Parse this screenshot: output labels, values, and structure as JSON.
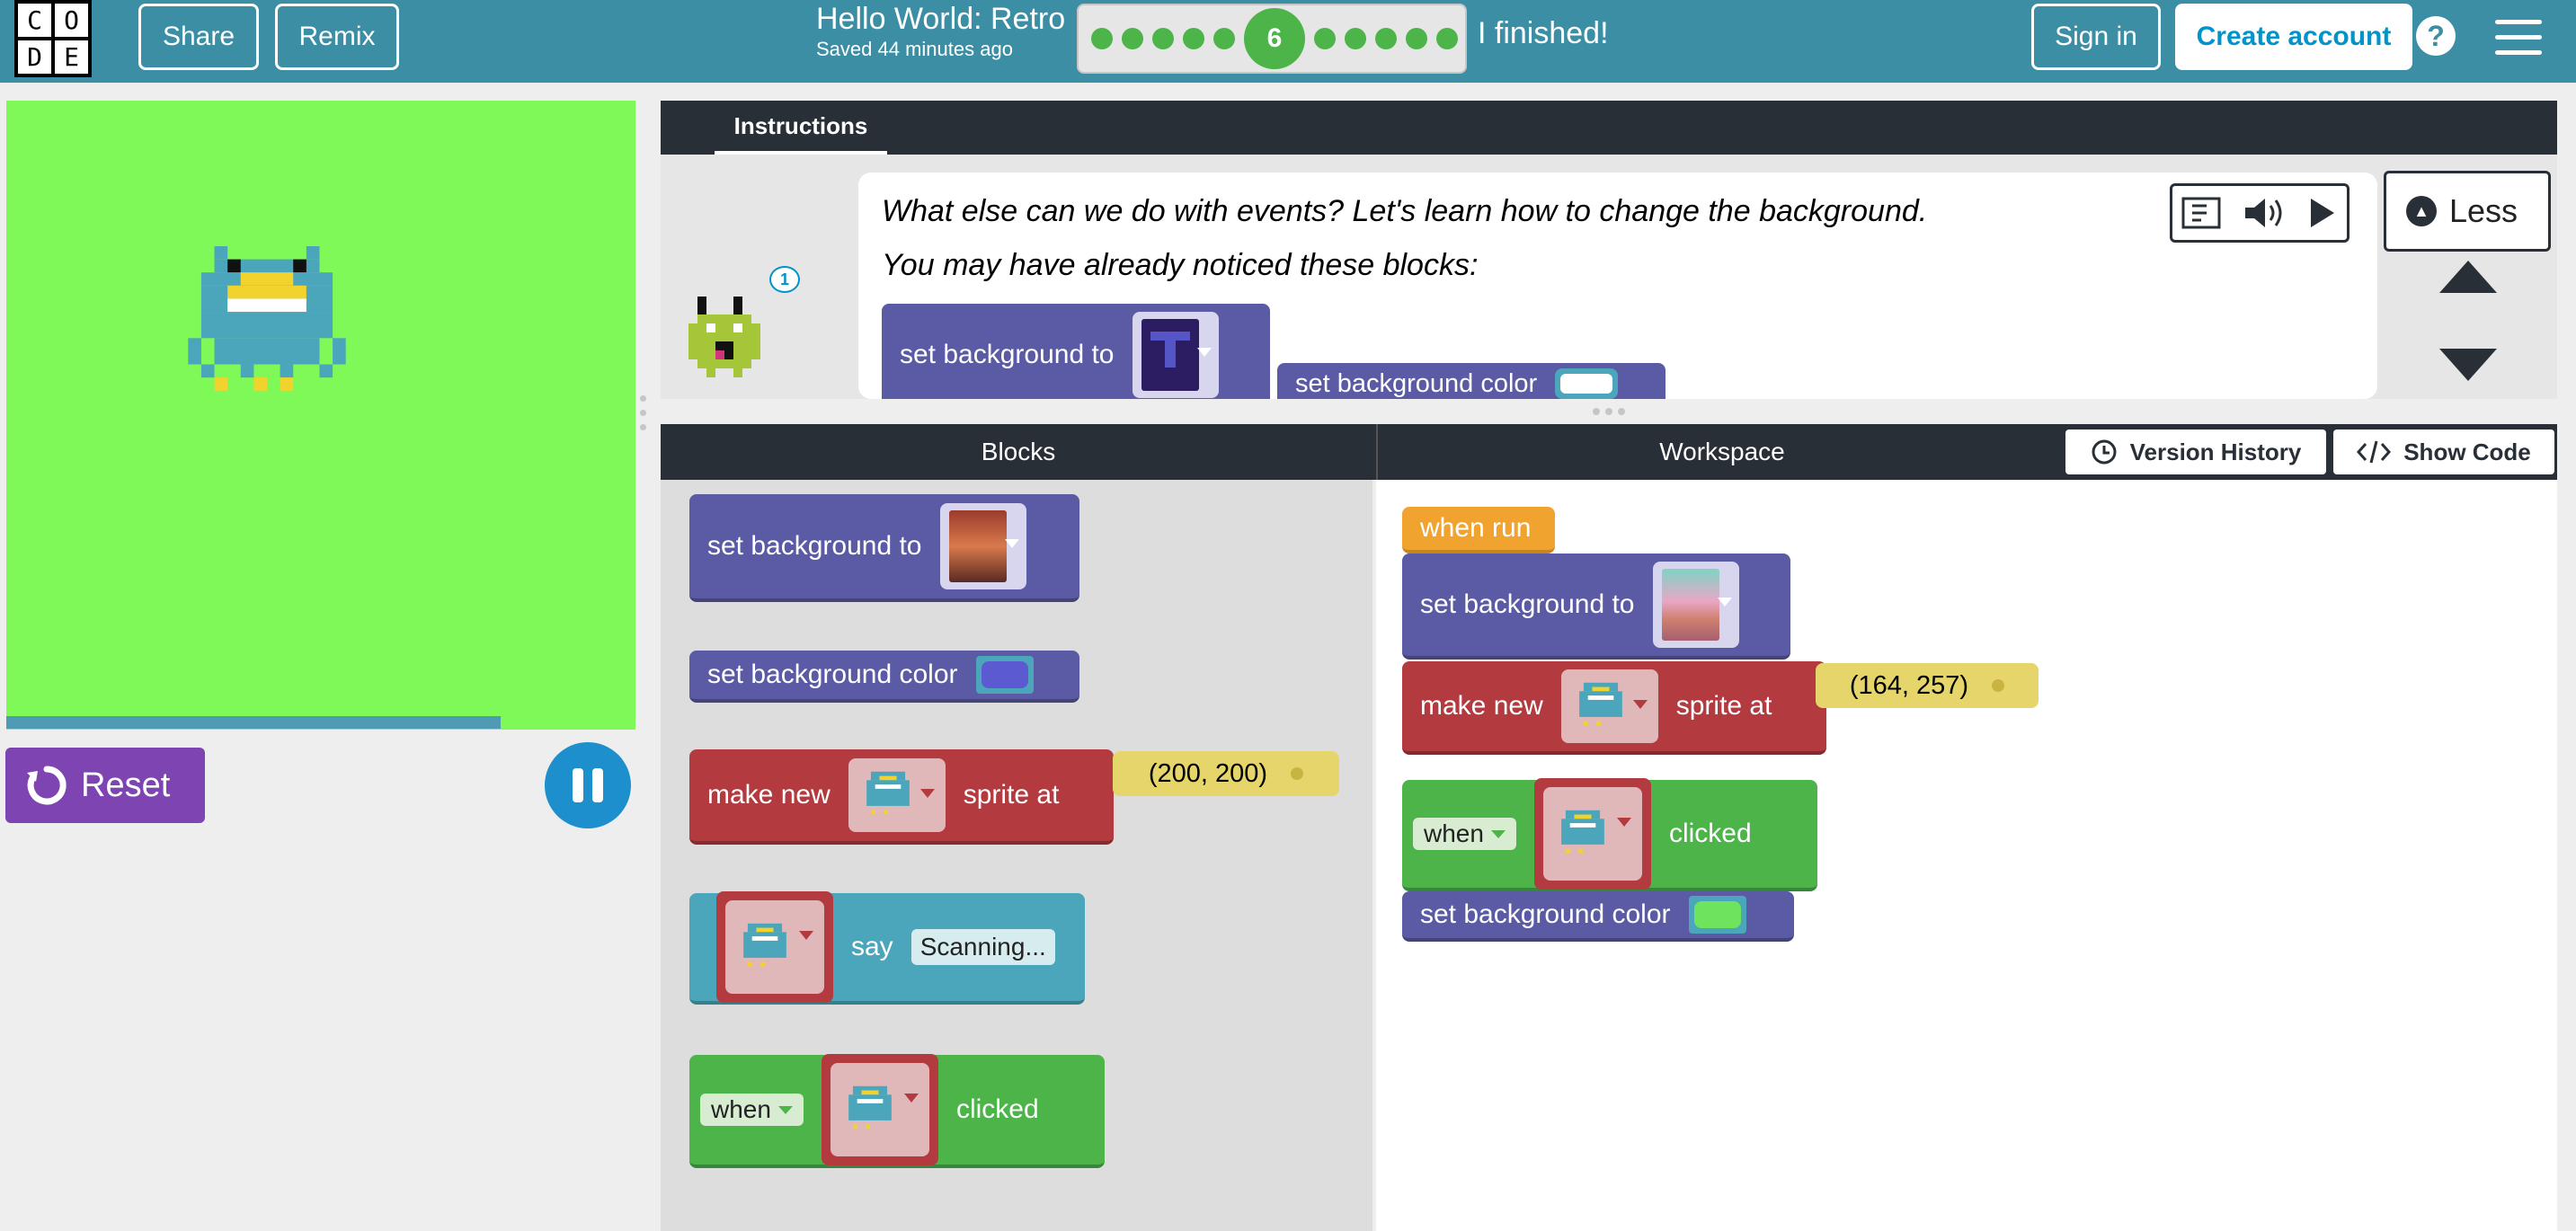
{
  "header": {
    "logo_letters": [
      "C",
      "O",
      "D",
      "E"
    ],
    "share_label": "Share",
    "remix_label": "Remix",
    "project_title": "Hello World: Retro",
    "saved_text": "Saved 44 minutes ago",
    "progress": {
      "current_level": "6",
      "dots_before": 5,
      "dots_after": 5,
      "dot_color": "#4cb449"
    },
    "finished_label": "I finished!",
    "sign_in_label": "Sign in",
    "create_account_label": "Create account",
    "help_label": "?",
    "accent_color": "#3c8ea5"
  },
  "stage": {
    "background_color": "#7ef957",
    "reset_label": "Reset"
  },
  "instructions": {
    "tab_label": "Instructions",
    "line1": "What else can we do with events? Let's learn how to change the background.",
    "line2": "You may have already noticed these blocks:",
    "bubble_count": "1",
    "less_label": "Less",
    "preview_blocks": {
      "set_bg_label": "set background to",
      "set_bg_color_label": "set background color"
    }
  },
  "editor": {
    "blocks_tab": "Blocks",
    "workspace_tab": "Workspace",
    "version_history_label": "Version History",
    "show_code_label": "Show Code"
  },
  "toolbox": {
    "set_bg_label": "set background to",
    "set_bg_color_label": "set background color",
    "make_new_label": "make new",
    "sprite_at_label": "sprite at",
    "coords": "(200, 200)",
    "say_label": "say",
    "say_text": "Scanning...",
    "when_label": "when",
    "clicked_label": "clicked"
  },
  "workspace": {
    "when_run_label": "when run",
    "set_bg_label": "set background to",
    "make_new_label": "make new",
    "sprite_at_label": "sprite at",
    "coords": "(164, 257)",
    "when_label": "when",
    "clicked_label": "clicked",
    "set_bg_color_label": "set background color",
    "bg_color_value": "#6ee35d"
  },
  "colors": {
    "purple_block": "#5b5aa4",
    "red_block": "#b33b40",
    "teal_block": "#4ba6bb",
    "green_block": "#4cb449",
    "orange_block": "#f1a330",
    "reset_button": "#7e44b2",
    "pause_button": "#1e8fcd"
  },
  "icons": [
    "reset-icon",
    "pause-icon",
    "read-aloud-icon",
    "speaker-icon",
    "play-icon",
    "chevron-up-icon",
    "clock-icon",
    "code-icon",
    "menu-icon",
    "help-icon"
  ]
}
